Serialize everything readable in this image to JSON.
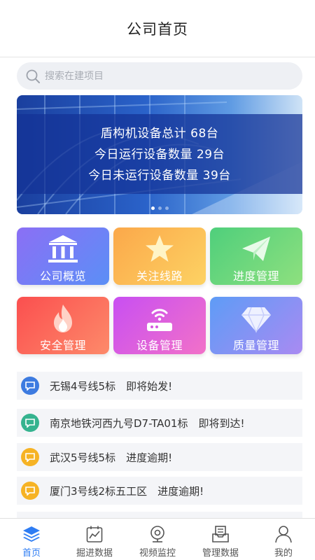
{
  "header": {
    "title": "公司首页"
  },
  "search": {
    "placeholder": "搜索在建项目"
  },
  "banner": {
    "lines": [
      "盾构机设备总计 68台",
      "今日运行设备数量 29台",
      "今日未运行设备数量 39台"
    ]
  },
  "tiles": [
    {
      "label": "公司概览",
      "icon": "bank-icon"
    },
    {
      "label": "关注线路",
      "icon": "star-icon"
    },
    {
      "label": "进度管理",
      "icon": "paper-plane-icon"
    },
    {
      "label": "安全管理",
      "icon": "flame-icon"
    },
    {
      "label": "设备管理",
      "icon": "router-icon"
    },
    {
      "label": "质量管理",
      "icon": "diamond-icon"
    }
  ],
  "notices": [
    {
      "text": "无锡4号线5标　即将始发!",
      "color": "#3d7be0"
    },
    {
      "text": "南京地铁河西九号D7-TA01标　即将到达!",
      "color": "#35b38f"
    },
    {
      "text": "武汉5号线5标　进度逾期!",
      "color": "#f6b325"
    },
    {
      "text": "厦门3号线2标五工区　进度逾期!",
      "color": "#f6b325"
    }
  ],
  "tabbar": {
    "items": [
      {
        "label": "首页",
        "icon": "layers-icon",
        "active": true
      },
      {
        "label": "掘进数据",
        "icon": "chart-icon",
        "active": false
      },
      {
        "label": "视频监控",
        "icon": "camera-icon",
        "active": false
      },
      {
        "label": "管理数据",
        "icon": "inbox-icon",
        "active": false
      },
      {
        "label": "我的",
        "icon": "user-icon",
        "active": false
      }
    ]
  },
  "colors": {
    "accent": "#2f7df3"
  }
}
